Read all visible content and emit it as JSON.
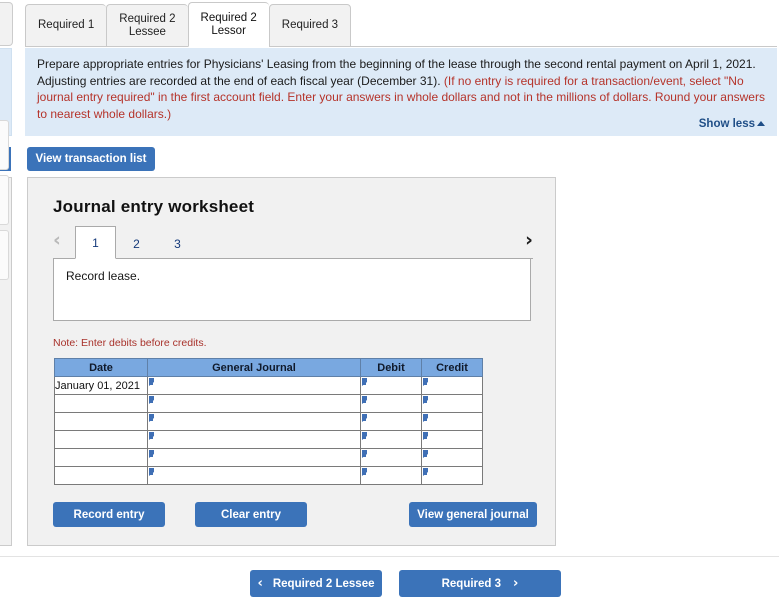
{
  "tabs": [
    {
      "label": "Required 1",
      "active": false
    },
    {
      "label": "Required 2\nLessee",
      "active": false
    },
    {
      "label": "Required 2\nLessor",
      "active": true
    },
    {
      "label": "Required 3",
      "active": false
    }
  ],
  "instructions": {
    "black_part": "Prepare appropriate entries for Physicians' Leasing from the beginning of the lease through the second rental payment on April 1, 2021. Adjusting entries are recorded at the end of each fiscal year (December 31). ",
    "red_part": "(If no entry is required for a transaction/event, select \"No journal entry required\" in the first account field. Enter your answers in whole dollars and not in the millions of dollars. Round your answers to nearest whole dollars.)",
    "show_less_label": "Show less",
    "background_color": "#ddeaf7"
  },
  "view_transaction_list_label": "View transaction list",
  "worksheet": {
    "title": "Journal entry worksheet",
    "pager": {
      "prev_icon": "chevron-left",
      "next_icon": "chevron-right",
      "prev_glyph": "‹",
      "next_glyph": "›",
      "pages": [
        {
          "label": "1",
          "active": true
        },
        {
          "label": "2",
          "active": false
        },
        {
          "label": "3",
          "active": false
        }
      ]
    },
    "memo": "Record lease.",
    "note": "Note: Enter debits before credits.",
    "table": {
      "headers": [
        "Date",
        "General Journal",
        "Debit",
        "Credit"
      ],
      "header_color": "#79a8e0",
      "rows": [
        {
          "date": "January 01, 2021",
          "general_journal": "",
          "debit": "",
          "credit": ""
        },
        {
          "date": "",
          "general_journal": "",
          "debit": "",
          "credit": ""
        },
        {
          "date": "",
          "general_journal": "",
          "debit": "",
          "credit": ""
        },
        {
          "date": "",
          "general_journal": "",
          "debit": "",
          "credit": ""
        },
        {
          "date": "",
          "general_journal": "",
          "debit": "",
          "credit": ""
        },
        {
          "date": "",
          "general_journal": "",
          "debit": "",
          "credit": ""
        }
      ]
    },
    "buttons": {
      "record_entry": "Record entry",
      "clear_entry": "Clear entry",
      "view_general_journal": "View general journal"
    }
  },
  "bottom_nav": {
    "prev_label": "Required 2 Lessee",
    "next_label": "Required 3",
    "prev_glyph": "‹",
    "next_glyph": "›"
  },
  "theme": {
    "button_blue": "#3b73b9",
    "link_blue": "#1f4e87",
    "red_text": "#b5332a"
  }
}
